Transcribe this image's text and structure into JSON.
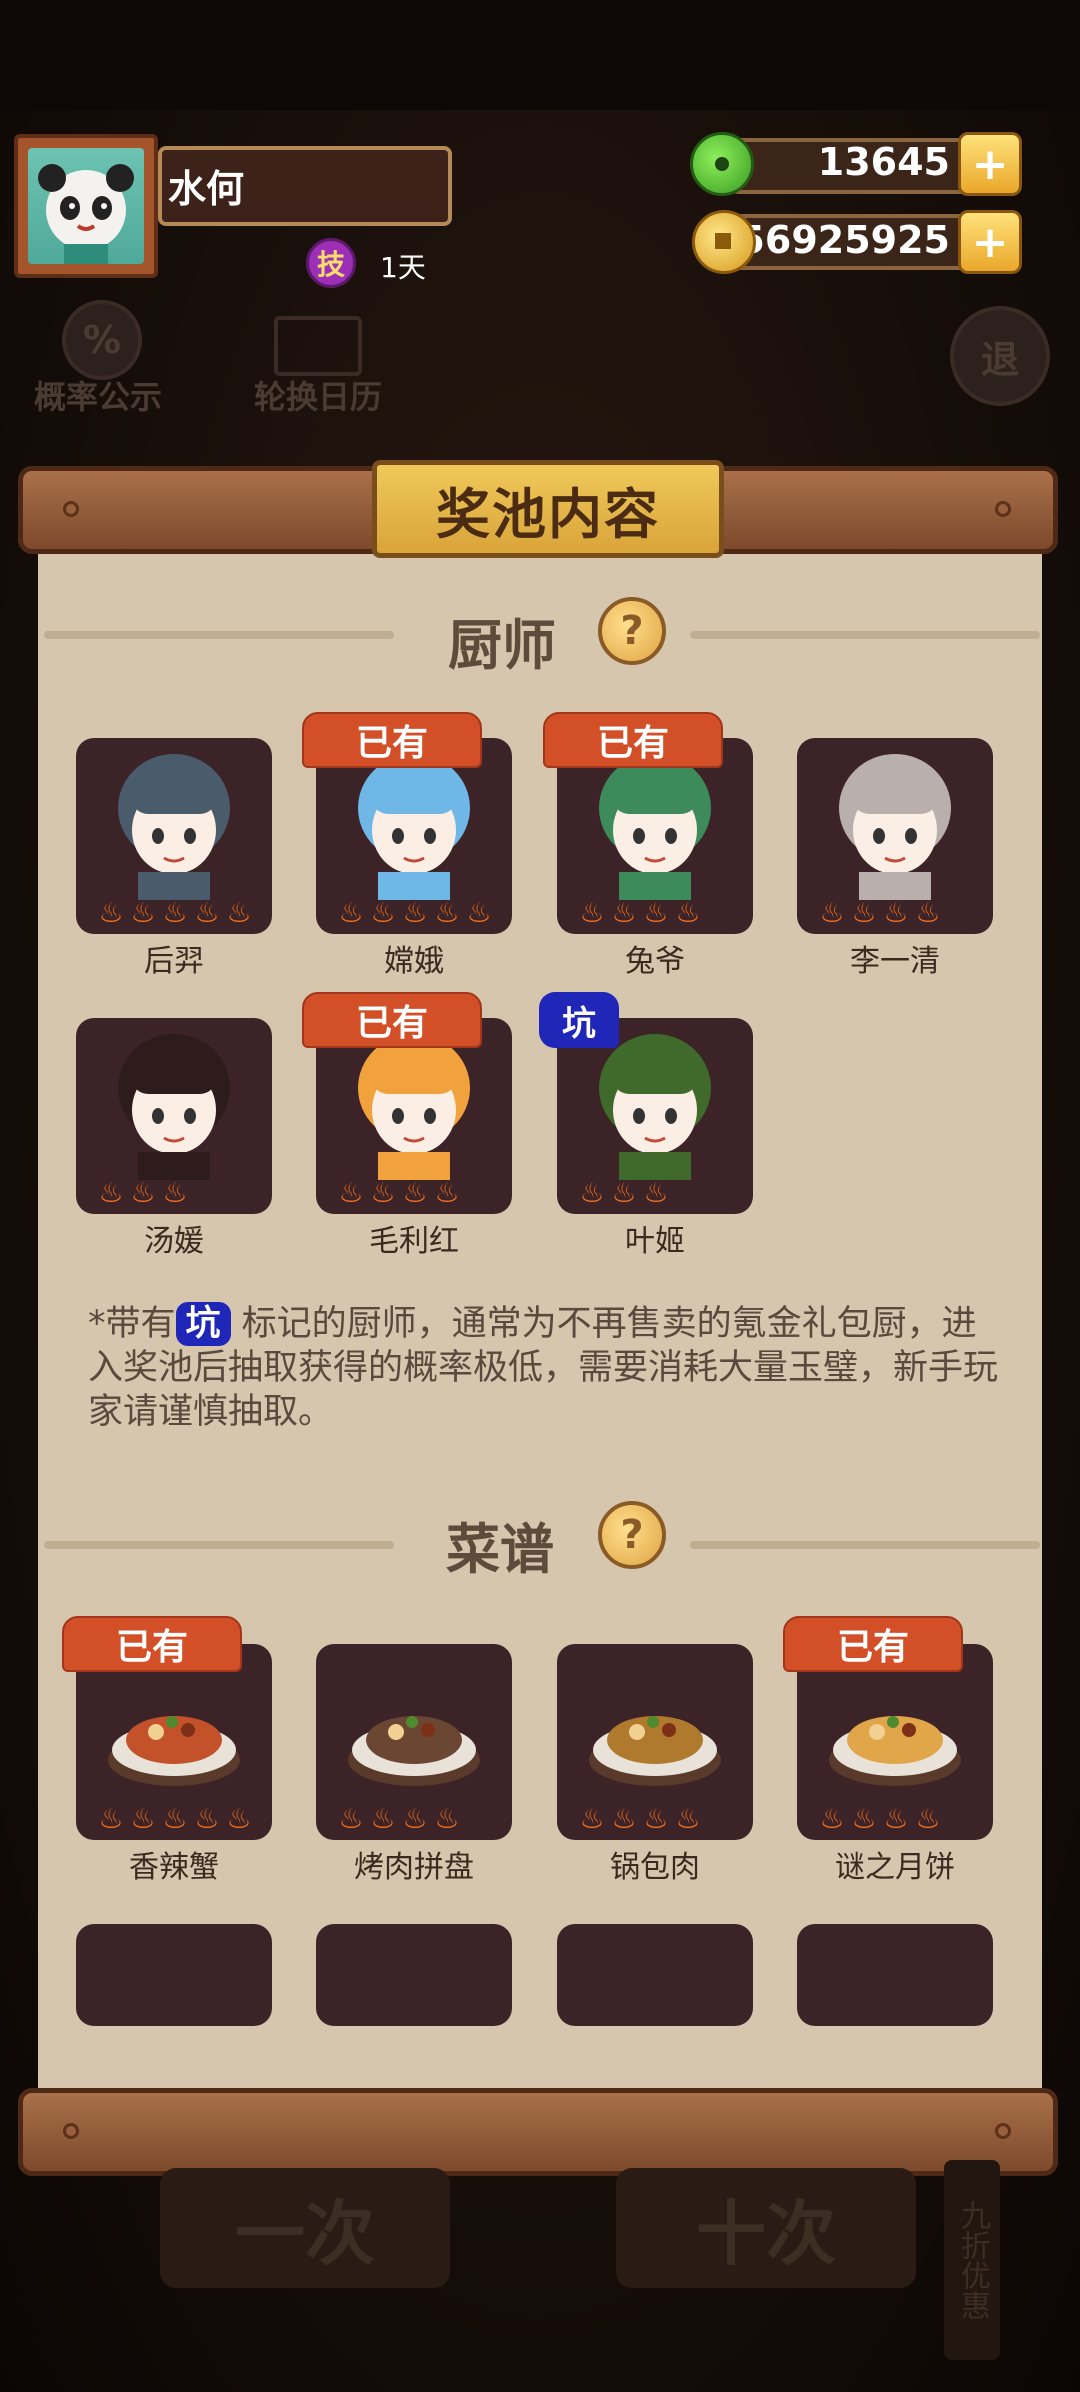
{
  "user": {
    "name": "水何",
    "skill_label": "技",
    "skill_duration": "1天"
  },
  "resources": {
    "jade": "13645",
    "coins": "56925925",
    "plus_label": "+"
  },
  "background": {
    "probability": "概率公示",
    "calendar": "轮换日历",
    "exit": "退",
    "pull_one": "一次",
    "pull_ten": "十次",
    "discount": "九折优惠"
  },
  "panel": {
    "title": "奖池内容",
    "chef_section": "厨师",
    "recipe_section": "菜谱",
    "help_label": "?"
  },
  "badges": {
    "owned": "已有",
    "pit": "坑"
  },
  "chefs": [
    {
      "name": "后羿",
      "stars": 5,
      "owned": false,
      "pit": false,
      "color": "#4a5b6b"
    },
    {
      "name": "嫦娥",
      "stars": 5,
      "owned": true,
      "pit": false,
      "color": "#6fb7e6"
    },
    {
      "name": "兔爷",
      "stars": 4,
      "owned": true,
      "pit": false,
      "color": "#3d8a5a"
    },
    {
      "name": "李一清",
      "stars": 4,
      "owned": false,
      "pit": false,
      "color": "#b9b0ad"
    },
    {
      "name": "汤媛",
      "stars": 3,
      "owned": false,
      "pit": false,
      "color": "#2e1c1c"
    },
    {
      "name": "毛利红",
      "stars": 4,
      "owned": true,
      "pit": false,
      "color": "#f2a23c"
    },
    {
      "name": "叶姬",
      "stars": 3,
      "owned": false,
      "pit": true,
      "color": "#3f6a2b"
    }
  ],
  "note": {
    "prefix": "*带有",
    "suffix": "标记的厨师，通常为不再售卖的氪金礼包厨，进入奖池后抽取获得的概率极低，需要消耗大量玉璧，新手玩家请谨慎抽取。"
  },
  "recipes": [
    {
      "name": "香辣蟹",
      "stars": 5,
      "owned": true,
      "color": "#c3522a"
    },
    {
      "name": "烤肉拼盘",
      "stars": 4,
      "owned": false,
      "color": "#6b4632"
    },
    {
      "name": "锅包肉",
      "stars": 4,
      "owned": false,
      "color": "#b07a2e"
    },
    {
      "name": "谜之月饼",
      "stars": 4,
      "owned": true,
      "color": "#e1a64a"
    }
  ],
  "flame_glyph": "♨"
}
